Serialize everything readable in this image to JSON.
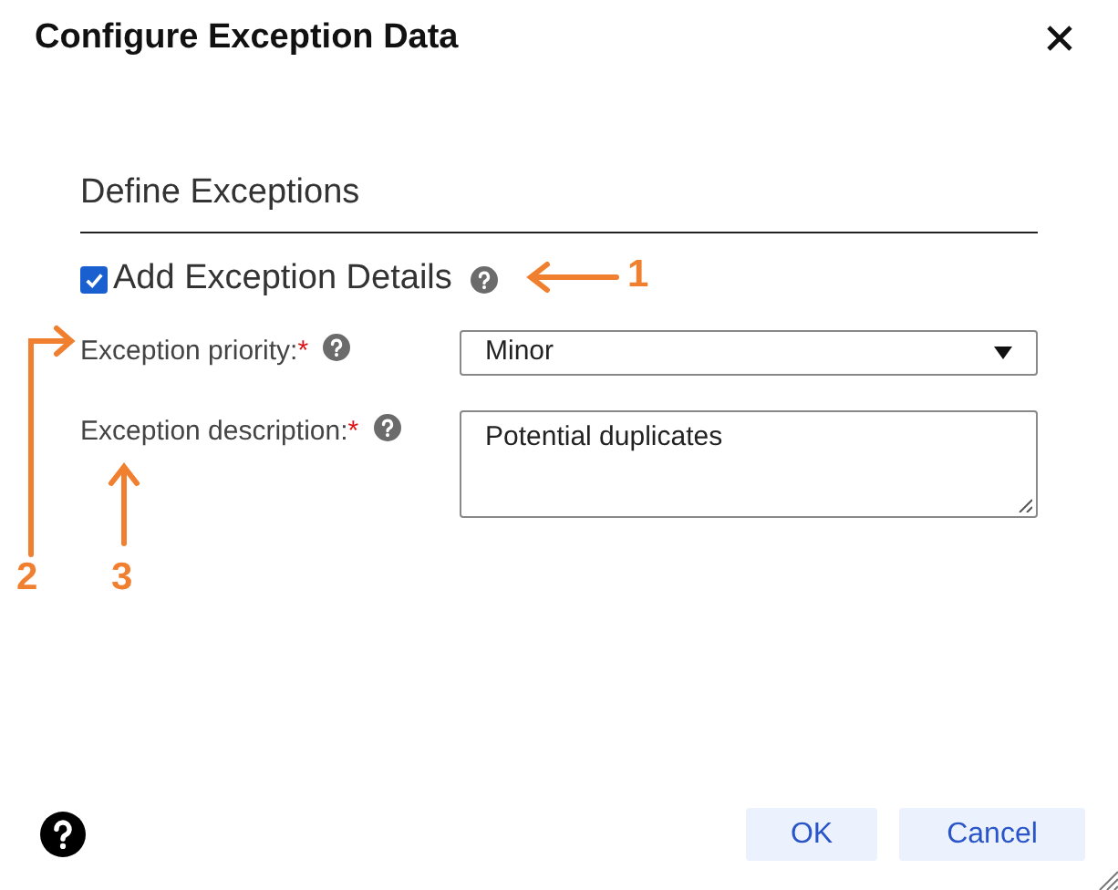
{
  "window": {
    "title": "Configure Exception Data"
  },
  "section": {
    "title": "Define Exceptions"
  },
  "add_details": {
    "label": "Add Exception Details",
    "checked": true
  },
  "fields": [
    {
      "kind": "select",
      "label": "Exception priority:",
      "required_mark": "*",
      "value": "Minor"
    },
    {
      "kind": "textarea",
      "label": "Exception description:",
      "required_mark": "*",
      "value": "Potential duplicates"
    }
  ],
  "buttons": [
    {
      "label": "OK"
    },
    {
      "label": "Cancel"
    }
  ],
  "callouts": [
    {
      "number": "1"
    },
    {
      "number": "2"
    },
    {
      "number": "3"
    }
  ]
}
